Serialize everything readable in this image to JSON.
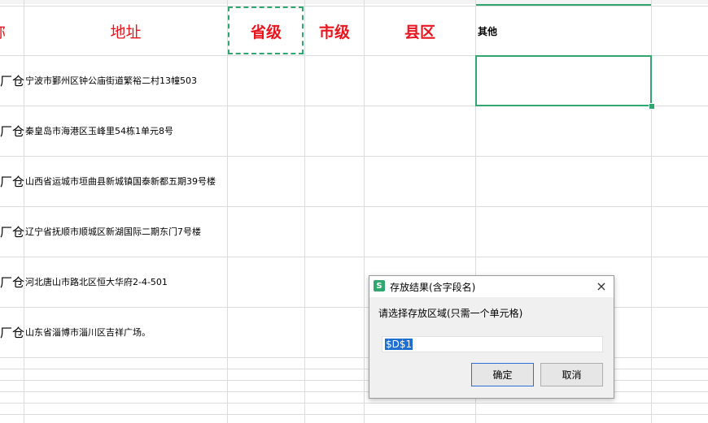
{
  "sheet": {
    "headers": {
      "name_partial": "称",
      "address": "地址",
      "province": "省级",
      "city": "市级",
      "county": "县区",
      "other": "其他"
    },
    "rows": [
      {
        "mark": "厂仓",
        "address": "宁波市鄞州区钟公庙街道繁裕二村13幢503"
      },
      {
        "mark": "厂仓",
        "address": "秦皇岛市海港区玉峰里54栋1单元8号"
      },
      {
        "mark": "厂仓",
        "address": "山西省运城市垣曲县新城镇国泰新都五期39号楼"
      },
      {
        "mark": "厂仓",
        "address": "辽宁省抚顺市顺城区新湖国际二期东门7号楼"
      },
      {
        "mark": "厂仓",
        "address": "河北唐山市路北区恒大华府2-4-501"
      },
      {
        "mark": "厂仓",
        "address": "山东省淄博市淄川区吉祥广场。"
      }
    ],
    "accent_color": "#2fa76e",
    "header_color": "#e8141e"
  },
  "dialog": {
    "icon": "S",
    "title": "存放结果(含字段名)",
    "prompt": "请选择存放区域(只需一个单元格)",
    "input_value": "$D$1",
    "ok_label": "确定",
    "cancel_label": "取消",
    "close_icon": "×"
  }
}
